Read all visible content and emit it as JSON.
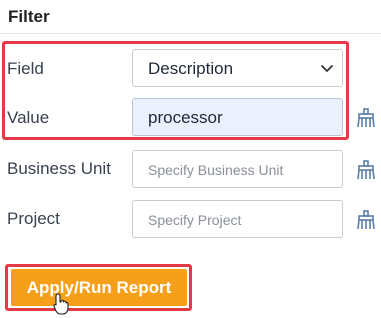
{
  "filter": {
    "title": "Filter",
    "rows": {
      "field": {
        "label": "Field",
        "value": "Description"
      },
      "value": {
        "label": "Value",
        "value": "processor"
      },
      "business_unit": {
        "label": "Business Unit",
        "placeholder": "Specify Business Unit"
      },
      "project": {
        "label": "Project",
        "placeholder": "Specify Project"
      }
    },
    "apply_button": {
      "label": "Apply/Run Report"
    }
  },
  "colors": {
    "highlight": "#e33b46",
    "button": "#f6a01a",
    "active_input": "#eaf1fd",
    "icon": "#5b7fa7"
  },
  "icons": [
    "chevron-down-icon",
    "broom-clear-icon",
    "mouse-pointer-icon"
  ]
}
